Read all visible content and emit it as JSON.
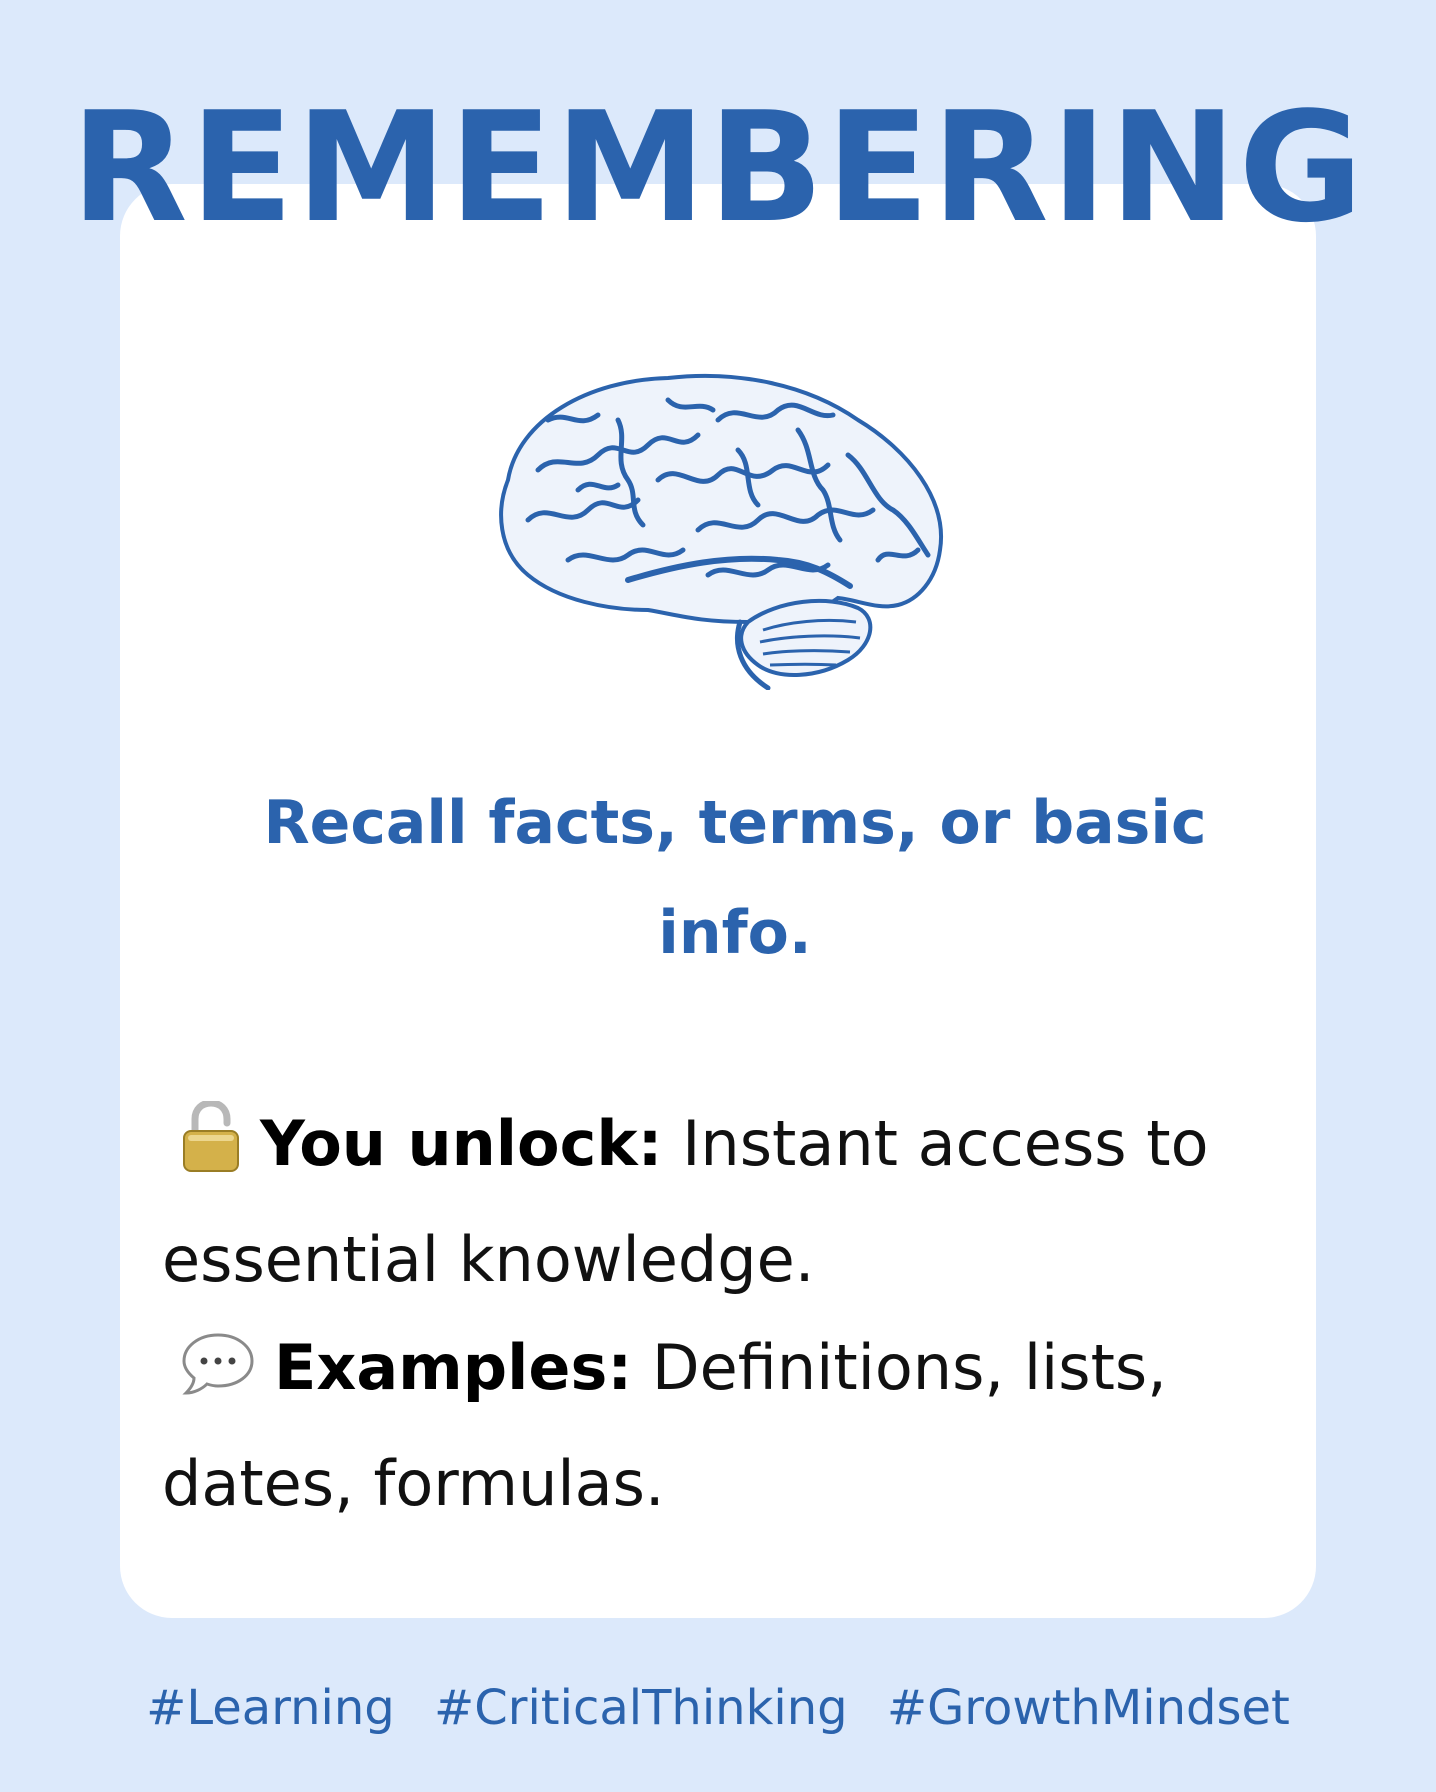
{
  "title": "REMEMBERING",
  "subtitle": "Recall facts, terms, or basic info.",
  "unlock": {
    "icon": "unlocked-padlock-icon",
    "label": "You unlock:",
    "text": " Instant access to essential knowledge."
  },
  "examples": {
    "icon": "speech-bubble-icon",
    "label": "Examples:",
    "text": " Definitions, lists, dates, formulas."
  },
  "hashtags": [
    "#Learning",
    "#CriticalThinking",
    "#GrowthMindset"
  ],
  "colors": {
    "background": "#dce9fb",
    "card": "#ffffff",
    "accent": "#2b63ad",
    "body_text": "#111111"
  }
}
